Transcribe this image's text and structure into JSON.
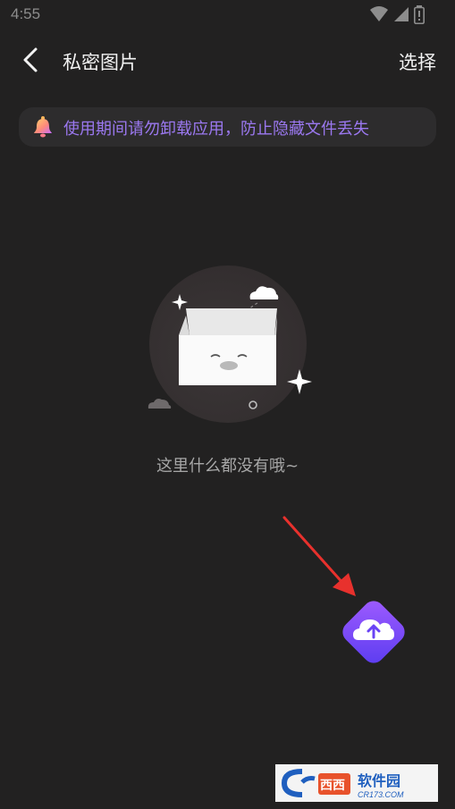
{
  "status_bar": {
    "time": "4:55",
    "icons": [
      "wifi-icon",
      "signal-icon",
      "battery-icon"
    ]
  },
  "header": {
    "title": "私密图片",
    "back_icon": "chevron-left-icon",
    "select_label": "选择"
  },
  "banner": {
    "icon": "bell-icon",
    "text": "使用期间请勿卸载应用，防止隐藏文件丢失"
  },
  "empty_state": {
    "illustration": "empty-box-illustration",
    "message": "这里什么都没有哦~"
  },
  "upload_button": {
    "icon": "cloud-upload-icon"
  },
  "watermark": {
    "logo_text": "西西软件园",
    "domain_text": "CR173.COM"
  },
  "colors": {
    "background": "#222121",
    "banner_bg": "#2d2c2d",
    "banner_text": "#9b78f0",
    "accent_start": "#a05cff",
    "accent_end": "#5a3cf0",
    "arrow": "#e8312d"
  }
}
